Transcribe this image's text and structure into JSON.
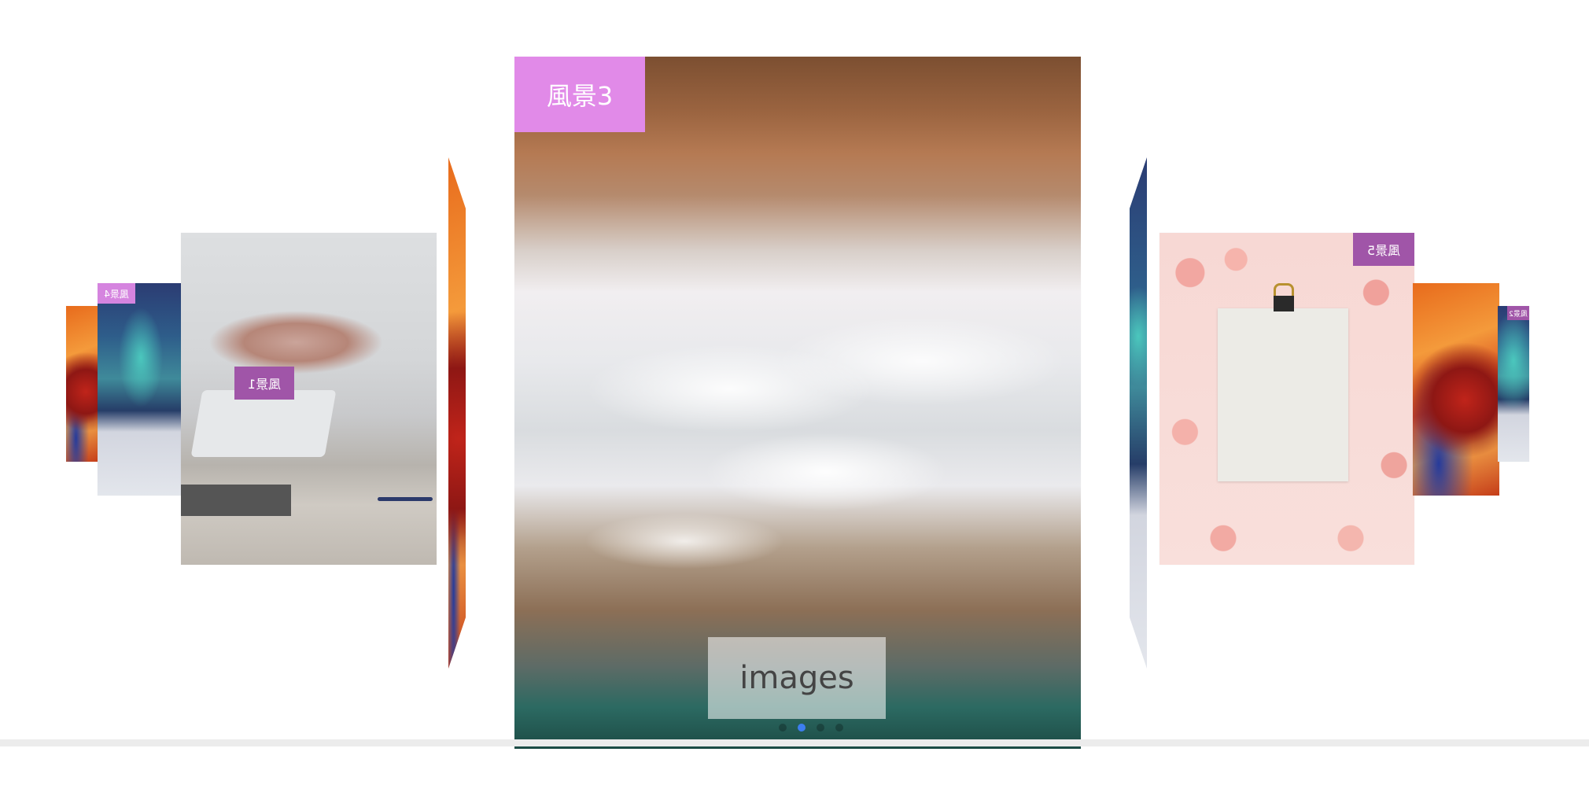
{
  "carousel": {
    "center_tag": "風景3",
    "caption": "images",
    "left_near_tag": "風景1",
    "left_far_tag": "風景4",
    "right_near_tag": "風景5",
    "right_far_tag": "風景2",
    "indicator_count": 4,
    "active_index": 2,
    "colors": {
      "tag_pink": "#e18ae8",
      "tag_purple": "#a055a8",
      "indicator_active": "#3d7ef0"
    }
  }
}
